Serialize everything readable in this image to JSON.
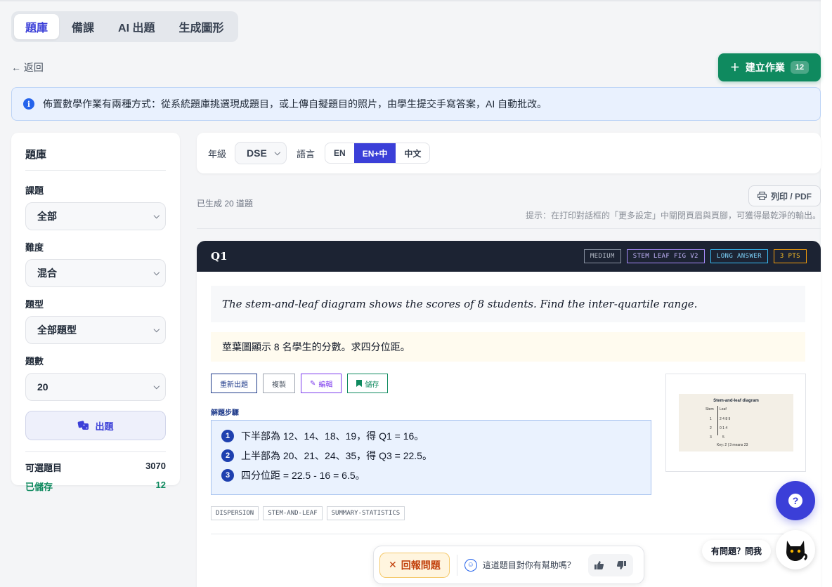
{
  "tabs": [
    "題庫",
    "備課",
    "AI 出題",
    "生成圖形"
  ],
  "active_tab": 0,
  "back_label": "← 返回",
  "create": {
    "label": "建立作業",
    "count": "12"
  },
  "info_text": "佈置數學作業有兩種方式：從系統題庫挑選現成題目，或上傳自擬題目的照片，由學生提交手寫答案，AI 自動批改。",
  "sidebar": {
    "title": "題庫",
    "fields": [
      {
        "label": "課題",
        "value": "全部"
      },
      {
        "label": "難度",
        "value": "混合"
      },
      {
        "label": "題型",
        "value": "全部題型"
      },
      {
        "label": "題數",
        "value": "20"
      }
    ],
    "generate_label": "出題",
    "stats": [
      {
        "label": "可選題目",
        "value": "3070"
      },
      {
        "label": "已儲存",
        "value": "12"
      }
    ]
  },
  "filter": {
    "grade_label": "年級",
    "grade_value": "DSE",
    "lang_label": "語言",
    "lang_options": [
      "EN",
      "EN+中",
      "中文"
    ],
    "lang_selected": 1
  },
  "count_text": "已生成 20 道題",
  "print_label": "列印 / PDF",
  "print_hint": "提示：在打印對話框的「更多設定」中關閉頁眉與頁腳，可獲得最乾淨的輸出。",
  "question": {
    "number": "Q1",
    "tags": [
      "MEDIUM",
      "STEM LEAF FIG V2",
      "LONG ANSWER",
      "3 PTS"
    ],
    "text_en": "The stem-and-leaf diagram shows the scores of 8 students. Find the inter-quartile range.",
    "text_zh": "莖葉圖顯示 8 名學生的分數。求四分位距。",
    "actions": [
      "重新出題",
      "複製",
      "編輯",
      "儲存"
    ],
    "steps_label": "解題步驟",
    "steps": [
      "下半部為 12、14、18、19，得 Q1 = 16。",
      "上半部為 20、21、24、35，得 Q3 = 22.5。",
      "四分位距 = 22.5 - 16 = 6.5。"
    ],
    "figure": {
      "title": "Stem-and-leaf diagram",
      "stem_header": "Stem",
      "leaf_header": "Leaf",
      "rows": [
        {
          "stem": "1",
          "leaf": "2 4 8 9"
        },
        {
          "stem": "2",
          "leaf": "0 1 4"
        },
        {
          "stem": "3",
          "leaf": "5"
        }
      ],
      "key": "Key: 2 | 3 means 23"
    },
    "chips": [
      "DISPERSION",
      "STEM-AND-LEAF",
      "SUMMARY-STATISTICS"
    ]
  },
  "feedback": {
    "report_label": "回報問題",
    "question": "這道題目對你有幫助嗎？"
  },
  "ask_label": "有問題？問我"
}
